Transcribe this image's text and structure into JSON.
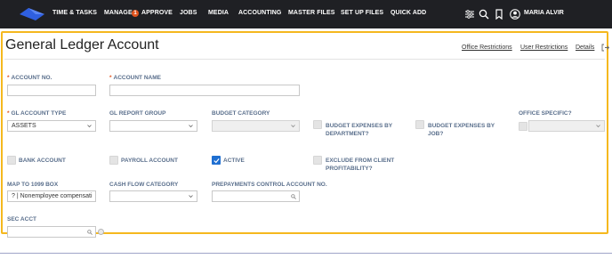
{
  "nav": {
    "items": [
      "TIME & TASKS",
      "MANAGE",
      "APPROVE",
      "JOBS",
      "MEDIA",
      "ACCOUNTING",
      "MASTER FILES",
      "SET UP FILES",
      "QUICK ADD"
    ],
    "badge": "1",
    "user_name": "MARIA ALVIR"
  },
  "page": {
    "title": "General Ledger Account",
    "links": [
      "Office Restrictions",
      "User Restrictions",
      "Details"
    ]
  },
  "form": {
    "account_no": {
      "label": "ACCOUNT NO.",
      "required": "*",
      "value": ""
    },
    "account_name": {
      "label": "ACCOUNT NAME",
      "required": "*",
      "value": ""
    },
    "gl_account_type": {
      "label": "GL ACCOUNT TYPE",
      "required": "*",
      "value": "ASSETS"
    },
    "gl_report_group": {
      "label": "GL REPORT GROUP",
      "value": ""
    },
    "budget_category": {
      "label": "BUDGET CATEGORY",
      "value": ""
    },
    "budget_expenses_department": {
      "label": "BUDGET EXPENSES BY DEPARTMENT?",
      "checked": false
    },
    "budget_expenses_job": {
      "label": "BUDGET EXPENSES BY JOB?",
      "checked": false
    },
    "office_specific": {
      "label": "OFFICE SPECIFIC?",
      "checked": false,
      "value": ""
    },
    "bank_account": {
      "label": "BANK ACCOUNT",
      "checked": false
    },
    "payroll_account": {
      "label": "PAYROLL ACCOUNT",
      "checked": false
    },
    "active": {
      "label": "ACTIVE",
      "checked": true
    },
    "exclude_profitability": {
      "label": "EXCLUDE FROM CLIENT PROFITABILITY?",
      "checked": false
    },
    "map_1099": {
      "label": "MAP TO 1099 BOX",
      "value": "? | Nonemployee compensati"
    },
    "cash_flow_category": {
      "label": "CASH FLOW CATEGORY",
      "value": ""
    },
    "prepayments_control": {
      "label": "PREPAYMENTS CONTROL ACCOUNT NO.",
      "value": ""
    },
    "sec_acct": {
      "label": "SEC ACCT",
      "value": ""
    }
  },
  "colors": {
    "nav_bg": "#1f2024",
    "accent": "#1f6fd1",
    "frame_highlight": "#f5b81e",
    "label": "#5a6f8c",
    "required": "#e0541f"
  },
  "icons": [
    "logo-icon",
    "filter-icon",
    "search-icon",
    "bookmark-icon",
    "user-icon",
    "exit-icon",
    "chevron-down-icon",
    "checkmark-icon",
    "lookup-search-icon"
  ]
}
